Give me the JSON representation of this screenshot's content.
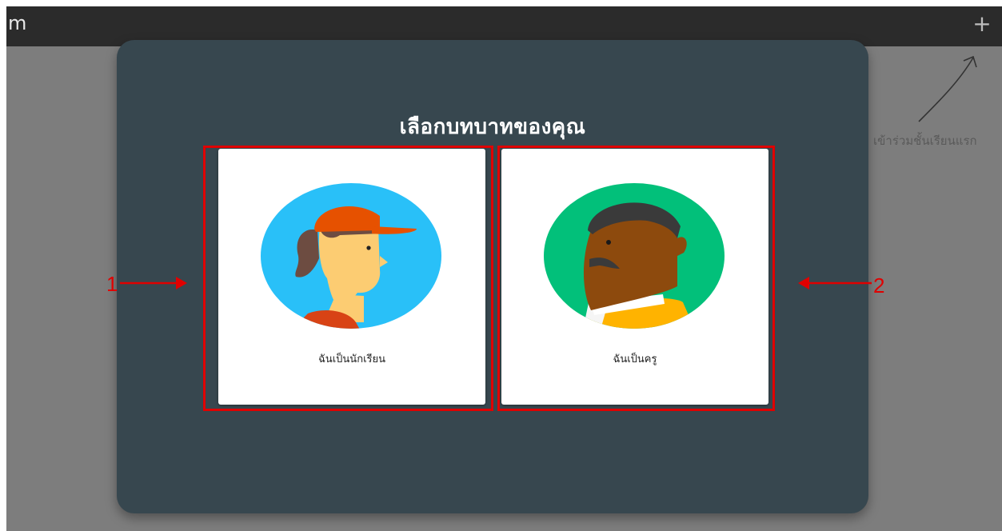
{
  "topbar": {
    "app_name_partial": "m",
    "add_icon": "plus-icon",
    "add_label": "+"
  },
  "hint": {
    "text": "เข้าร่วมชั้นเรียนแรก",
    "arrow_icon": "curved-arrow-icon"
  },
  "modal": {
    "title": "เลือกบทบาทของคุณ",
    "roles": [
      {
        "label": "ฉันเป็นนักเรียน",
        "illustration": "student-avatar-illustration"
      },
      {
        "label": "ฉันเป็นครู",
        "illustration": "teacher-avatar-illustration"
      }
    ]
  },
  "annotations": {
    "marker_1": "1",
    "marker_2": "2",
    "highlight_color": "#e00000"
  },
  "colors": {
    "modal_bg": "#37474f",
    "topbar_bg": "#2b2b2b",
    "backdrop": "#7d7d7d",
    "student_bg": "#29c0f8",
    "teacher_bg": "#02c07a",
    "cap": "#e65100"
  }
}
